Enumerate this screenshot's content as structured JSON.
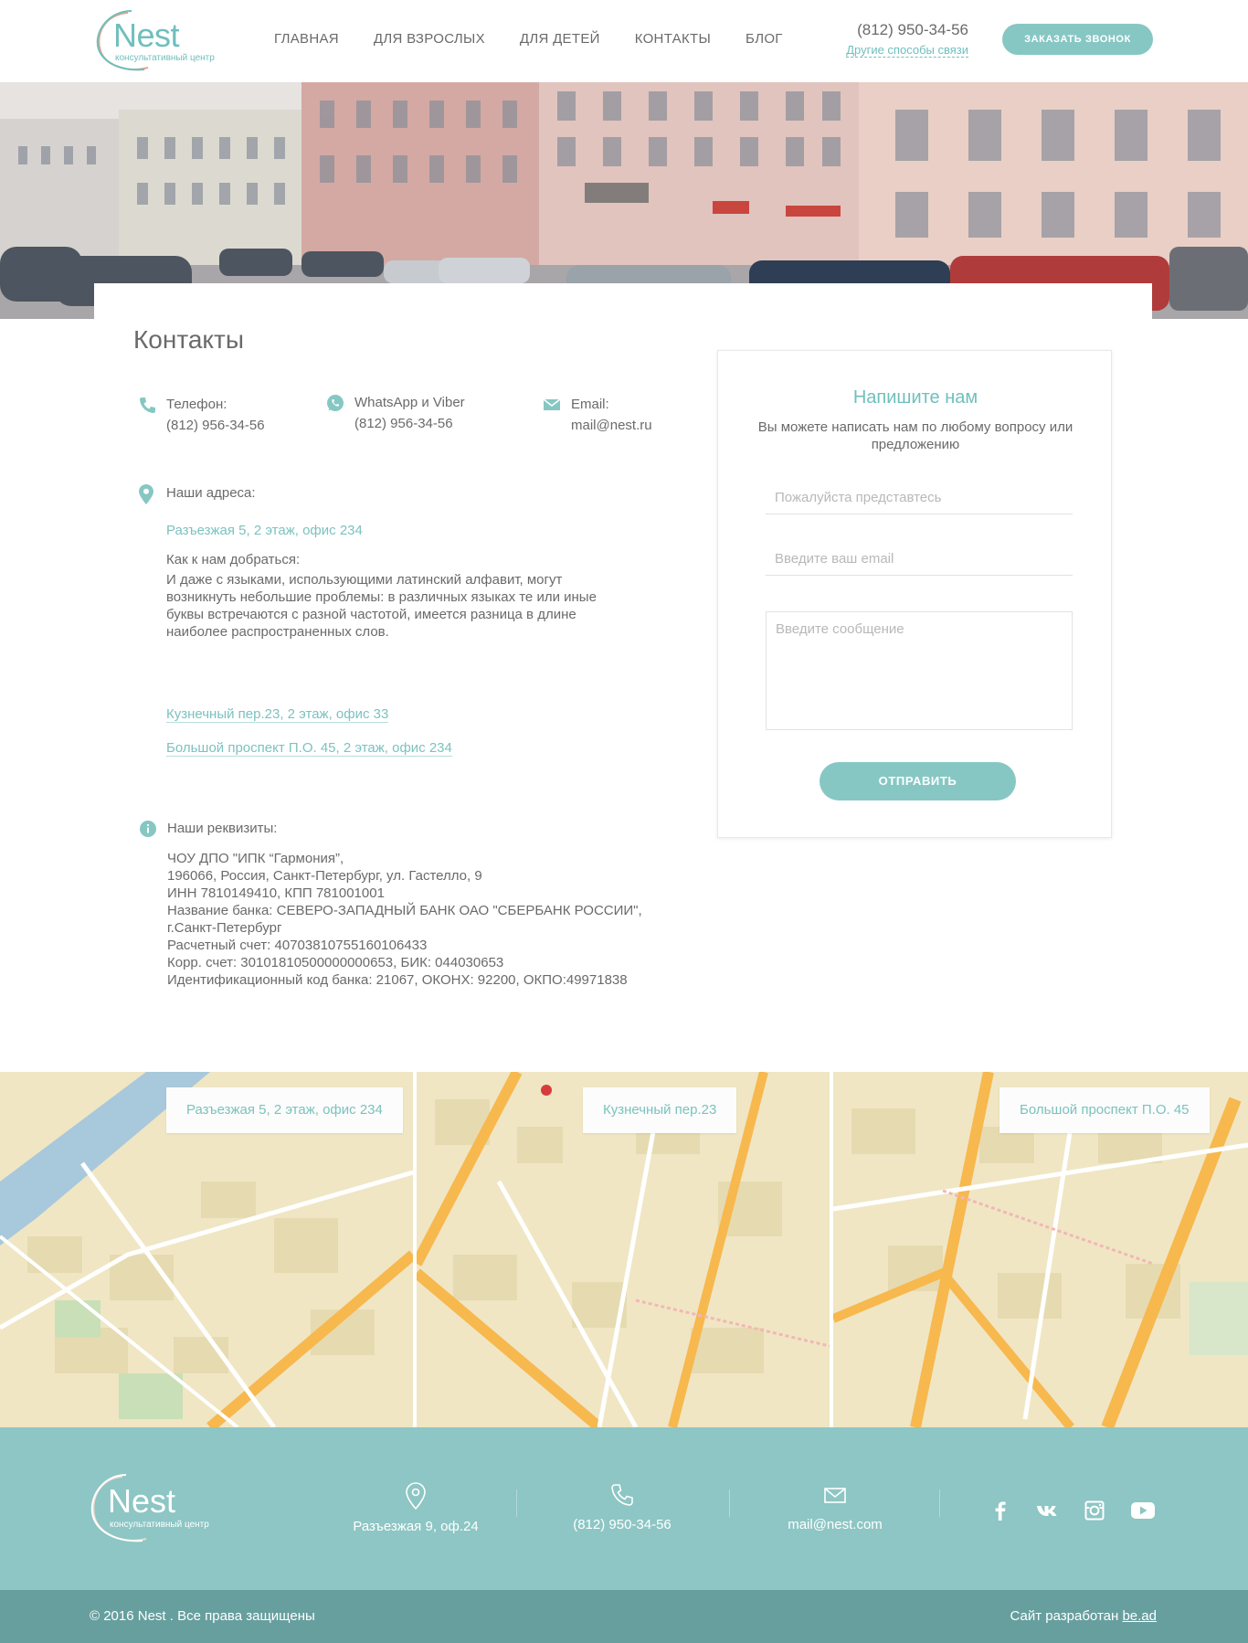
{
  "brand": {
    "name": "Nest",
    "tagline": "консультативный центр",
    "accent": "#86c7c4"
  },
  "nav": [
    {
      "label": "Главная"
    },
    {
      "label": "Для взрослых"
    },
    {
      "label": "Для детей"
    },
    {
      "label": "Контакты"
    },
    {
      "label": "Блог"
    }
  ],
  "header": {
    "phone": "(812) 950-34-56",
    "other_contacts": "Другие способы связи",
    "callback_button": "Заказать звонок"
  },
  "page": {
    "title": "Контакты"
  },
  "contacts": {
    "phone": {
      "label": "Телефон:",
      "value": "(812) 956-34-56",
      "icon": "phone-icon"
    },
    "messengers": {
      "label": "WhatsApp и Viber",
      "value": "(812) 956-34-56",
      "icon": "whatsapp-icon"
    },
    "email": {
      "label": "Email:",
      "value": "mail@nest.ru",
      "icon": "mail-icon"
    }
  },
  "addresses": {
    "label": "Наши адреса:",
    "primary": "Разъезжая 5, 2 этаж, офис 234",
    "how_title": "Как к нам добраться:",
    "how_text": "И даже с языками, использующими латинский алфавит, могут возникнуть небольшие проблемы: в различных языках те или иные буквы встречаются с разной частотой, имеется разница в длине наиболее распространенных слов.",
    "secondary": "Кузнечный пер.23, 2 этаж, офис 33",
    "tertiary": "Большой проспект П.О. 45, 2 этаж, офис 234"
  },
  "requisites": {
    "label": "Наши реквизиты:",
    "lines": [
      "ЧОУ ДПО \"ИПК “Гармония”,",
      "196066, Россия, Санкт-Петербург, ул. Гастелло, 9",
      "ИНН 7810149410, КПП 781001001",
      "Название банка: СЕВЕРО-ЗАПАДНЫЙ БАНК ОАО \"СБЕРБАНК РОССИИ\",",
      "г.Санкт-Петербург",
      "Расчетный счет: 40703810755160106433",
      "Корр. счет: 30101810500000000653, БИК: 044030653",
      "Идентификационный код банка: 21067, ОКОНХ: 92200, ОКПО:49971838"
    ]
  },
  "form": {
    "title": "Напишите нам",
    "subtitle": "Вы можете написать нам по любому вопросу или предложению",
    "name_placeholder": "Пожалуйста представтесь",
    "email_placeholder": "Введите ваш email",
    "message_placeholder": "Введите сообщение",
    "submit": "Отправить"
  },
  "maps": [
    {
      "label": "Разъезжая 5, 2 этаж, офис 234"
    },
    {
      "label": "Кузнечный пер.23"
    },
    {
      "label": "Большой проспект П.О. 45"
    }
  ],
  "footer": {
    "address": "Разъезжая 9, оф.24",
    "phone": "(812) 950-34-56",
    "email": "mail@nest.com",
    "social": [
      "facebook-icon",
      "vk-icon",
      "instagram-icon",
      "youtube-icon"
    ],
    "copyright": "© 2016 Nest . Все права защищены",
    "developer_prefix": "Сайт разработан",
    "developer_link": "be.ad"
  }
}
